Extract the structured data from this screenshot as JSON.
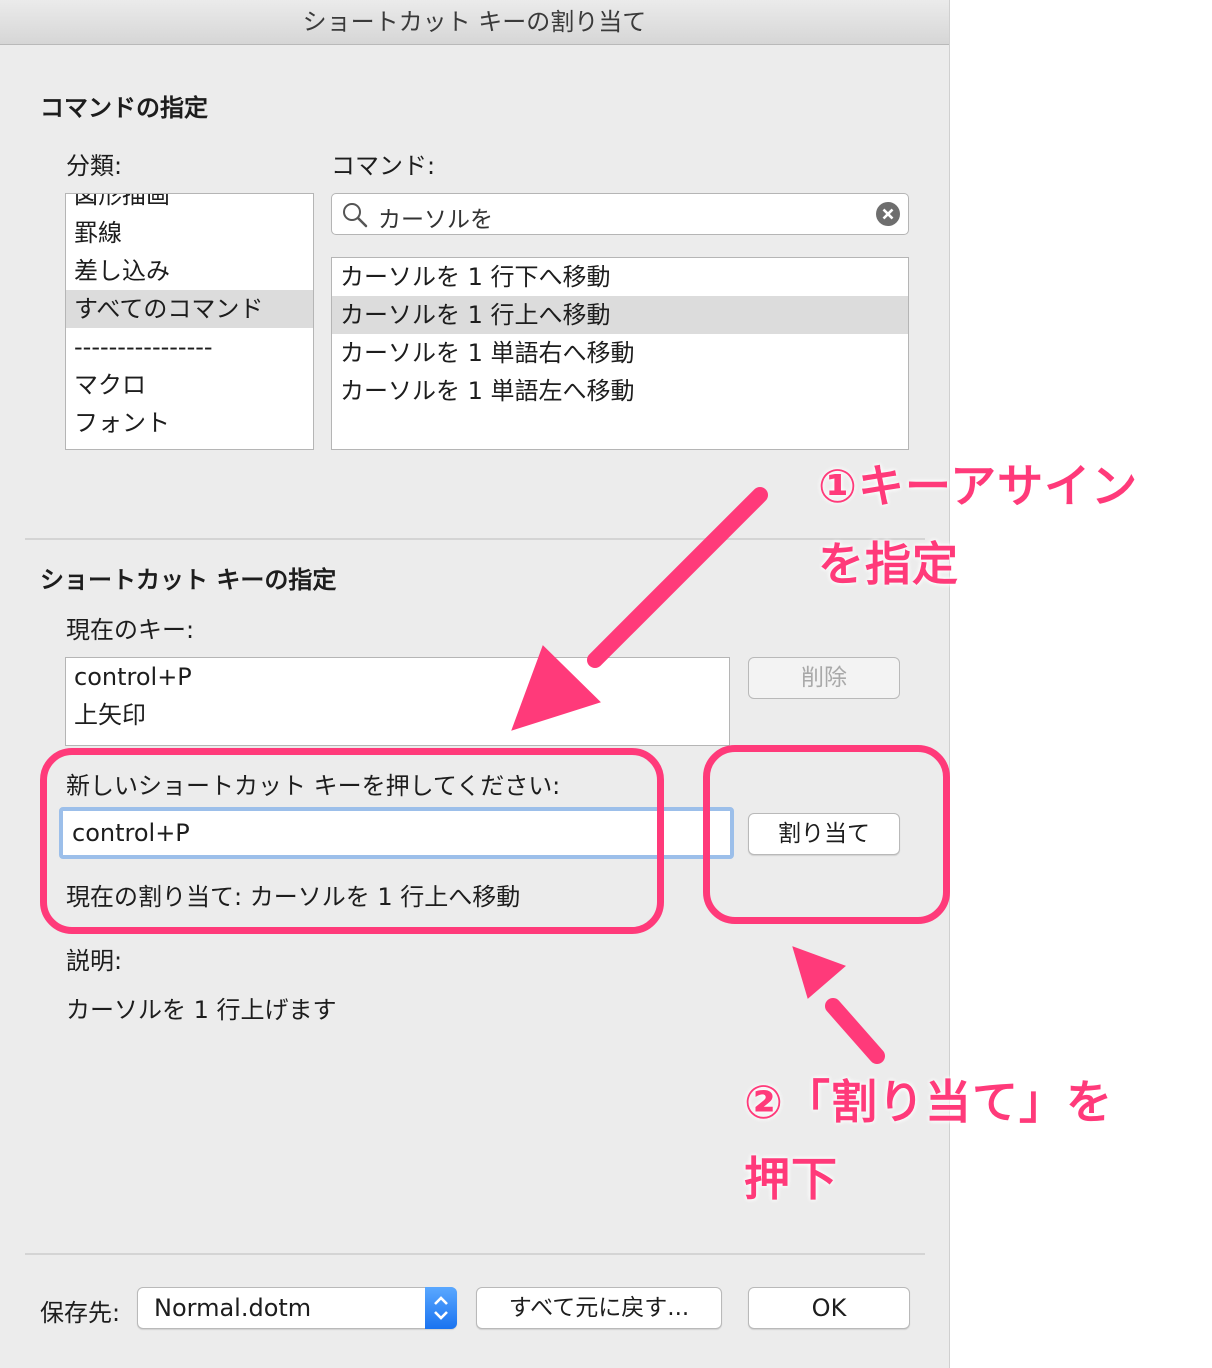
{
  "window": {
    "title": "ショートカット キーの割り当て"
  },
  "command_section": {
    "heading": "コマンドの指定",
    "category_label": "分類:",
    "categories": [
      "図形描画",
      "罫線",
      "差し込み",
      "すべてのコマンド",
      "----------------",
      "マクロ",
      "フォント"
    ],
    "selected_category": "すべてのコマンド",
    "command_label": "コマンド:",
    "search": {
      "value": "カーソルを"
    },
    "commands": [
      "カーソルを 1 行下へ移動",
      "カーソルを 1 行上へ移動",
      "カーソルを 1 単語右へ移動",
      "カーソルを 1 単語左へ移動"
    ],
    "selected_command": "カーソルを 1 行上へ移動"
  },
  "shortcut_section": {
    "heading": "ショートカット キーの指定",
    "current_keys_label": "現在のキー:",
    "current_keys": [
      "control+P",
      "上矢印"
    ],
    "delete_button": "削除",
    "new_key_label": "新しいショートカット キーを押してください:",
    "new_key_value": "control+P",
    "assign_button": "割り当て",
    "current_assignment": "現在の割り当て: カーソルを 1 行上へ移動",
    "description_label": "説明:",
    "description": "カーソルを 1 行上げます"
  },
  "footer": {
    "save_label": "保存先:",
    "save_target": "Normal.dotm",
    "reset_button": "すべて元に戻す...",
    "ok_button": "OK"
  },
  "annotations": {
    "step1_line1": "①キーアサイン",
    "step1_line2": "を指定",
    "step2_line1": "②「割り当て」を",
    "step2_line2": "押下",
    "color": "#ff3a7a"
  }
}
